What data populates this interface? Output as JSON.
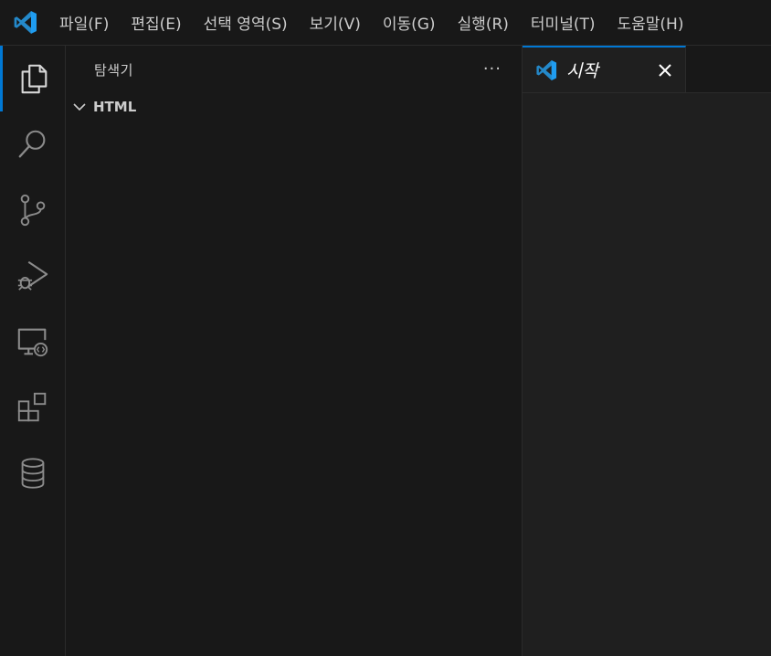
{
  "menubar": {
    "items": [
      "파일(F)",
      "편집(E)",
      "선택 영역(S)",
      "보기(V)",
      "이동(G)",
      "실행(R)",
      "터미널(T)",
      "도움말(H)"
    ]
  },
  "activitybar": {
    "items": [
      {
        "icon": "explorer-icon",
        "active": true
      },
      {
        "icon": "search-icon",
        "active": false
      },
      {
        "icon": "source-control-icon",
        "active": false
      },
      {
        "icon": "run-debug-icon",
        "active": false
      },
      {
        "icon": "remote-explorer-icon",
        "active": false
      },
      {
        "icon": "extensions-icon",
        "active": false
      },
      {
        "icon": "database-icon",
        "active": false
      }
    ]
  },
  "sidebar": {
    "title": "탐색기",
    "more_label": "···",
    "folder": "HTML"
  },
  "editor": {
    "tabs": [
      {
        "label": "시작",
        "close_label": "×"
      }
    ]
  },
  "colors": {
    "background": "#181818",
    "editor_background": "#1f1f1f",
    "accent": "#0078d4",
    "vscode_blue": "#2489ca",
    "text": "#cccccc"
  }
}
